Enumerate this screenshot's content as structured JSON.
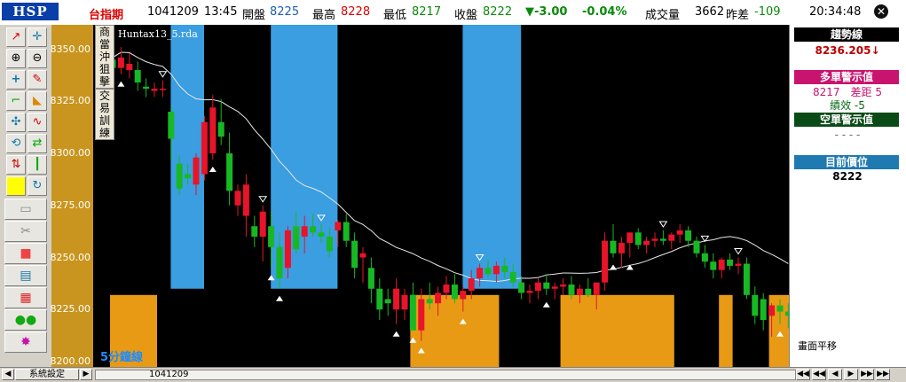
{
  "header": {
    "logo": "HSP",
    "symbol": "台指期",
    "date": "1041209",
    "time": "13:45",
    "open_label": "開盤",
    "open": "8225",
    "high_label": "最高",
    "high": "8228",
    "low_label": "最低",
    "low": "8217",
    "close_label": "收盤",
    "close": "8222",
    "change": "▼-3.00",
    "change_pct": "-0.04%",
    "volume_label": "成交量",
    "volume": "3662",
    "diff_label": "昨差",
    "diff": "-109",
    "clock": "20:34:48",
    "close_button": "✕"
  },
  "toolbar": {
    "icons": [
      "line-draw-icon",
      "crosshair-icon",
      "zoom-in-icon",
      "zoom-out-icon",
      "add-icon",
      "pencil-icon",
      "unlock-icon",
      "edit-icon",
      "fan-icon",
      "wave-icon",
      "rotate-icon",
      "swap-icon",
      "chart-move-icon",
      "candle-icon",
      "yellow-box-icon",
      "refresh-icon"
    ],
    "wide_icons": [
      "folder-icon",
      "scissors-icon",
      "stop-icon",
      "notes-icon",
      "grid-icon",
      "gloves-icon",
      "burst-icon"
    ]
  },
  "tabs": {
    "left": "商當沖狙擊",
    "right": "交易訓練"
  },
  "chart": {
    "filename": "Huntax13_5.rda",
    "period_label": "5分鐘線"
  },
  "right_panel": {
    "trend_header": "趨勢線",
    "trend_value": "8236.205↓",
    "long_header": "多單警示值",
    "long_value": "8217　差距 5",
    "long_perf": "績效 -5",
    "short_header": "空單警示值",
    "short_value": "- - - -",
    "pos_header": "目前價位",
    "pos_value": "8222",
    "shift_label": "畫面平移"
  },
  "footer": {
    "settings": "系統設定",
    "date": "1041209",
    "nav_labels": [
      "◀◀",
      "◀◀",
      "◀",
      "▶",
      "▶▶",
      "▶▶"
    ]
  },
  "colors": {
    "up": "#e8142a",
    "down": "#18b824",
    "orange": "#e89a14",
    "blue": "#3a9ee0",
    "trend_header": "#000000",
    "long_header": "#c8146e",
    "short_header": "#0a4a16",
    "pos_header": "#1e7ab0"
  },
  "chart_data": {
    "type": "candlestick",
    "title": "",
    "ylabel": "",
    "ylim": [
      8200,
      8360
    ],
    "y_ticks": [
      "8350.00",
      "8325.00",
      "8300.00",
      "8275.00",
      "8250.00",
      "8225.00",
      "8200.00"
    ],
    "candles": [
      [
        8345,
        8348,
        8337,
        8341
      ],
      [
        8341,
        8351,
        8338,
        8346
      ],
      [
        8340,
        8348,
        8336,
        8343
      ],
      [
        8340,
        8344,
        8330,
        8334
      ],
      [
        8332,
        8336,
        8327,
        8331
      ],
      [
        8330,
        8334,
        8327,
        8331
      ],
      [
        8331,
        8335,
        8327,
        8331
      ],
      [
        8320,
        8322,
        8297,
        8307
      ],
      [
        8295,
        8299,
        8280,
        8283
      ],
      [
        8290,
        8295,
        8285,
        8288
      ],
      [
        8285,
        8300,
        8280,
        8298
      ],
      [
        8290,
        8318,
        8287,
        8315
      ],
      [
        8300,
        8328,
        8297,
        8322
      ],
      [
        8315,
        8326,
        8304,
        8308
      ],
      [
        8300,
        8310,
        8275,
        8282
      ],
      [
        8275,
        8285,
        8270,
        8282
      ],
      [
        8270,
        8290,
        8260,
        8285
      ],
      [
        8265,
        8270,
        8255,
        8260
      ],
      [
        8260,
        8275,
        8248,
        8272
      ],
      [
        8265,
        8272,
        8245,
        8255
      ],
      [
        8255,
        8262,
        8235,
        8240
      ],
      [
        8245,
        8265,
        8240,
        8263
      ],
      [
        8265,
        8272,
        8252,
        8254
      ],
      [
        8260,
        8270,
        8252,
        8265
      ],
      [
        8265,
        8271,
        8260,
        8262
      ],
      [
        8262,
        8266,
        8257,
        8260
      ],
      [
        8260,
        8264,
        8250,
        8253
      ],
      [
        8263,
        8268,
        8255,
        8267
      ],
      [
        8267,
        8271,
        8255,
        8258
      ],
      [
        8258,
        8262,
        8240,
        8245
      ],
      [
        8250,
        8255,
        8238,
        8252
      ],
      [
        8245,
        8250,
        8228,
        8235
      ],
      [
        8235,
        8240,
        8220,
        8225
      ],
      [
        8230,
        8235,
        8222,
        8228
      ],
      [
        8225,
        8240,
        8218,
        8235
      ],
      [
        8225,
        8235,
        8220,
        8232
      ],
      [
        8232,
        8238,
        8215,
        8215
      ],
      [
        8215,
        8235,
        8210,
        8230
      ],
      [
        8230,
        8238,
        8225,
        8228
      ],
      [
        8228,
        8236,
        8222,
        8233
      ],
      [
        8233,
        8241,
        8230,
        8237
      ],
      [
        8237,
        8242,
        8228,
        8230
      ],
      [
        8230,
        8236,
        8224,
        8234
      ],
      [
        8234,
        8244,
        8230,
        8240
      ],
      [
        8240,
        8247,
        8236,
        8245
      ],
      [
        8245,
        8249,
        8240,
        8242
      ],
      [
        8242,
        8248,
        8238,
        8246
      ],
      [
        8246,
        8250,
        8240,
        8243
      ],
      [
        8243,
        8247,
        8236,
        8238
      ],
      [
        8238,
        8241,
        8230,
        8233
      ],
      [
        8233,
        8237,
        8228,
        8234
      ],
      [
        8234,
        8240,
        8230,
        8238
      ],
      [
        8238,
        8242,
        8232,
        8235
      ],
      [
        8235,
        8238,
        8230,
        8236
      ],
      [
        8236,
        8240,
        8232,
        8237
      ],
      [
        8237,
        8241,
        8230,
        8232
      ],
      [
        8232,
        8237,
        8228,
        8235
      ],
      [
        8235,
        8240,
        8231,
        8232
      ],
      [
        8232,
        8236,
        8225,
        8238
      ],
      [
        8238,
        8262,
        8234,
        8258
      ],
      [
        8258,
        8266,
        8250,
        8252
      ],
      [
        8252,
        8260,
        8245,
        8257
      ],
      [
        8257,
        8262,
        8250,
        8262
      ],
      [
        8262,
        8264,
        8254,
        8256
      ],
      [
        8256,
        8260,
        8252,
        8258
      ],
      [
        8258,
        8262,
        8255,
        8259
      ],
      [
        8259,
        8263,
        8256,
        8258
      ],
      [
        8258,
        8262,
        8254,
        8261
      ],
      [
        8261,
        8266,
        8257,
        8263
      ],
      [
        8263,
        8265,
        8255,
        8258
      ],
      [
        8258,
        8260,
        8250,
        8252
      ],
      [
        8252,
        8256,
        8245,
        8248
      ],
      [
        8248,
        8252,
        8240,
        8244
      ],
      [
        8244,
        8250,
        8240,
        8249
      ],
      [
        8249,
        8252,
        8244,
        8246
      ],
      [
        8246,
        8250,
        8242,
        8247
      ],
      [
        8247,
        8250,
        8230,
        8232
      ],
      [
        8232,
        8236,
        8218,
        8222
      ],
      [
        8230,
        8233,
        8215,
        8220
      ],
      [
        8222,
        8228,
        8212,
        8227
      ],
      [
        8227,
        8230,
        8218,
        8224
      ],
      [
        8224,
        8228,
        8216,
        8222
      ]
    ]
  }
}
